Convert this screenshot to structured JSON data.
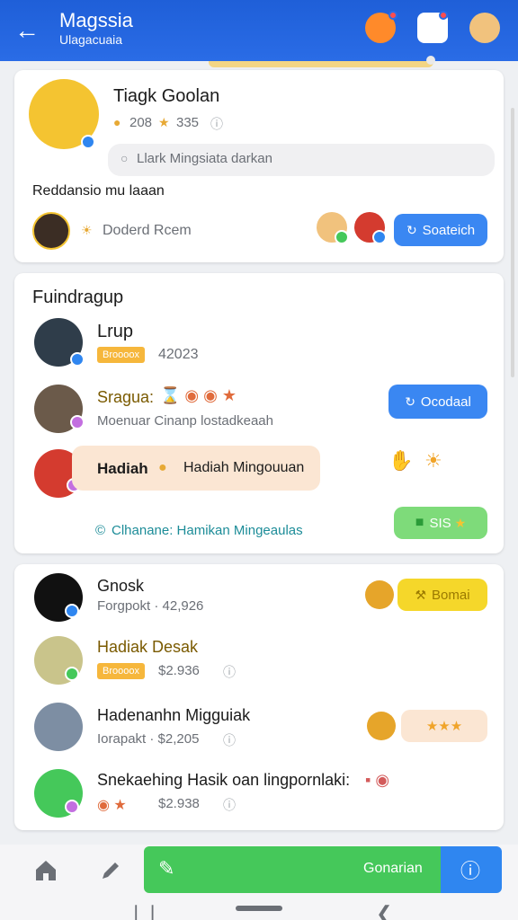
{
  "header": {
    "title": "Magssia",
    "subtitle": "Ulagacuaia"
  },
  "profile": {
    "name": "Tiagk Goolan",
    "stat_a": "208",
    "stat_b": "335",
    "link_text": "Llark Mingsiata darkan",
    "description": "Reddansio mu laaan",
    "room_label": "Doderd Rcem",
    "action_button": "Soateich"
  },
  "group": {
    "title": "Fuindragup",
    "items": [
      {
        "name": "Lrup",
        "tag": "Broooox",
        "value": "42023"
      },
      {
        "name": "Sragua:",
        "desc": "Moenuar Cinanp lostadkeaah",
        "button": "Ocodaal"
      },
      {
        "name": "Hadiah",
        "desc": "Hadiah Mingouuan"
      },
      {
        "footer": "Clhanane: Hamikan Mingeaulas",
        "badge": "SIS"
      }
    ]
  },
  "list": {
    "items": [
      {
        "name": "Gnosk",
        "sub": "Forgpokt · 42,926",
        "action": "Bomai"
      },
      {
        "name": "Hadiak Desak",
        "tag": "Broooox",
        "value": "$2.936"
      },
      {
        "name": "Hadenanhn Migguiak",
        "sub": "Iorapakt · $2,205"
      },
      {
        "name": "Snekaehing Hasik oan lingpornlaki:",
        "value": "$2.938"
      }
    ]
  },
  "bottom": {
    "primary_label": "Gonarian"
  },
  "colors": {
    "primary": "#2a6ce6",
    "green": "#45c85a",
    "accent_yellow": "#f6b73c"
  }
}
